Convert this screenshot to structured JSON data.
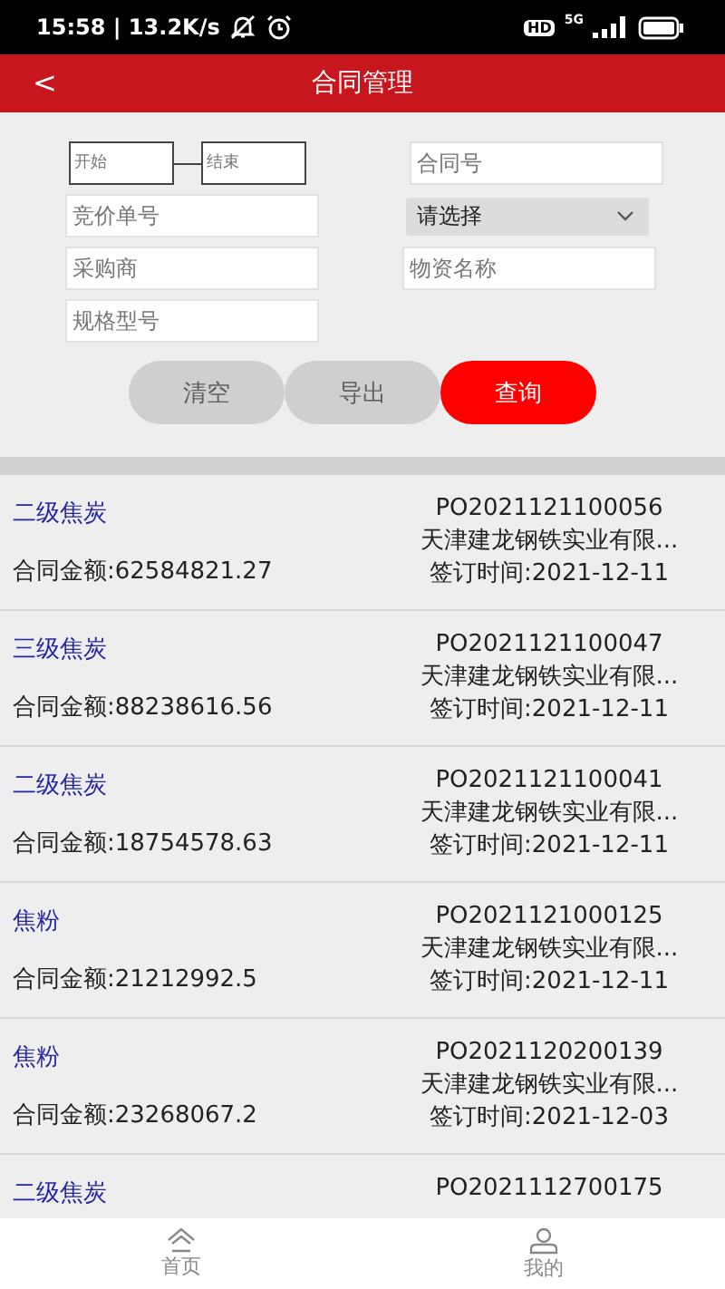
{
  "status_bar": {
    "time": "15:58 | 13.2K/s",
    "hd": "HD",
    "network": "5G"
  },
  "header": {
    "back": "<",
    "title": "合同管理"
  },
  "filters": {
    "start": {
      "placeholder": "开始"
    },
    "end": {
      "placeholder": "结束"
    },
    "contract_no": {
      "placeholder": "合同号"
    },
    "bid_no": {
      "placeholder": "竞价单号"
    },
    "status_select": {
      "value": "请选择"
    },
    "buyer": {
      "placeholder": "采购商"
    },
    "material": {
      "placeholder": "物资名称"
    },
    "spec": {
      "placeholder": "规格型号"
    }
  },
  "buttons": [
    {
      "label": "清空",
      "kind": "secondary"
    },
    {
      "label": "导出",
      "kind": "secondary"
    },
    {
      "label": "查询",
      "kind": "primary"
    }
  ],
  "contracts": [
    {
      "name": "二级焦炭",
      "po": "PO2021121100056",
      "company": "天津建龙钢铁实业有限...",
      "amount": "合同金额:62584821.27",
      "date": "签订时间:2021-12-11"
    },
    {
      "name": "三级焦炭",
      "po": "PO2021121100047",
      "company": "天津建龙钢铁实业有限...",
      "amount": "合同金额:88238616.56",
      "date": "签订时间:2021-12-11"
    },
    {
      "name": "二级焦炭",
      "po": "PO2021121100041",
      "company": "天津建龙钢铁实业有限...",
      "amount": "合同金额:18754578.63",
      "date": "签订时间:2021-12-11"
    },
    {
      "name": "焦粉",
      "po": "PO2021121000125",
      "company": "天津建龙钢铁实业有限...",
      "amount": "合同金额:21212992.5",
      "date": "签订时间:2021-12-11"
    },
    {
      "name": "焦粉",
      "po": "PO2021120200139",
      "company": "天津建龙钢铁实业有限...",
      "amount": "合同金额:23268067.2",
      "date": "签订时间:2021-12-03"
    },
    {
      "name": "二级焦炭",
      "po": "PO2021112700175"
    }
  ],
  "tab_bar": [
    {
      "label": "首页",
      "kind": "home",
      "selected": false
    },
    {
      "label": "我的",
      "kind": "profile",
      "selected": false
    }
  ]
}
